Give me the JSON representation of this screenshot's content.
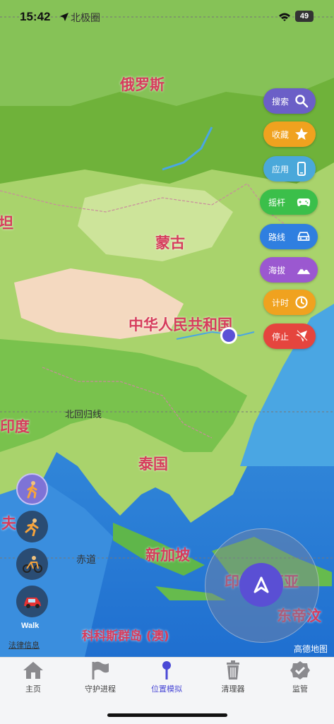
{
  "status": {
    "time": "15:42",
    "location_label": "北极圈",
    "battery": "49"
  },
  "map_labels": {
    "russia": "俄罗斯",
    "mongolia": "蒙古",
    "china": "中华人民共和国",
    "india": "印度",
    "thailand": "泰国",
    "singapore": "新加坡",
    "indonesia": "印度尼西亚",
    "east_timor": "东帝汶",
    "cocos": "科科斯群岛 (澳)",
    "maldives": "夫",
    "kazakh": "坦",
    "tropic": "北回归线",
    "equator": "赤道",
    "legal": "法律信息",
    "attribution": "高德地图"
  },
  "side_buttons": [
    {
      "label": "搜索",
      "icon": "search-icon",
      "color": "#6b5fc7"
    },
    {
      "label": "收藏",
      "icon": "star-icon",
      "color": "#f0a21f"
    },
    {
      "label": "应用",
      "icon": "phone-icon",
      "color": "#4aa8da"
    },
    {
      "label": "摇杆",
      "icon": "gamepad-icon",
      "color": "#3bbf4a"
    },
    {
      "label": "路线",
      "icon": "car-icon",
      "color": "#2f7fe0"
    },
    {
      "label": "海拔",
      "icon": "mountain-icon",
      "color": "#9b58d0"
    },
    {
      "label": "计时",
      "icon": "timer-icon",
      "color": "#f0a21f"
    },
    {
      "label": "停止",
      "icon": "stop-location-icon",
      "color": "#e5453e"
    }
  ],
  "modes": {
    "walk_label": "Walk"
  },
  "tabs": [
    {
      "label": "主页",
      "icon": "house-icon"
    },
    {
      "label": "守护进程",
      "icon": "flag-icon"
    },
    {
      "label": "位置模拟",
      "icon": "pin-icon"
    },
    {
      "label": "清理器",
      "icon": "trash-icon"
    },
    {
      "label": "监管",
      "icon": "shield-check-icon"
    }
  ],
  "colors": {
    "accent": "#4a49d6",
    "label_red": "#d63c5c"
  }
}
